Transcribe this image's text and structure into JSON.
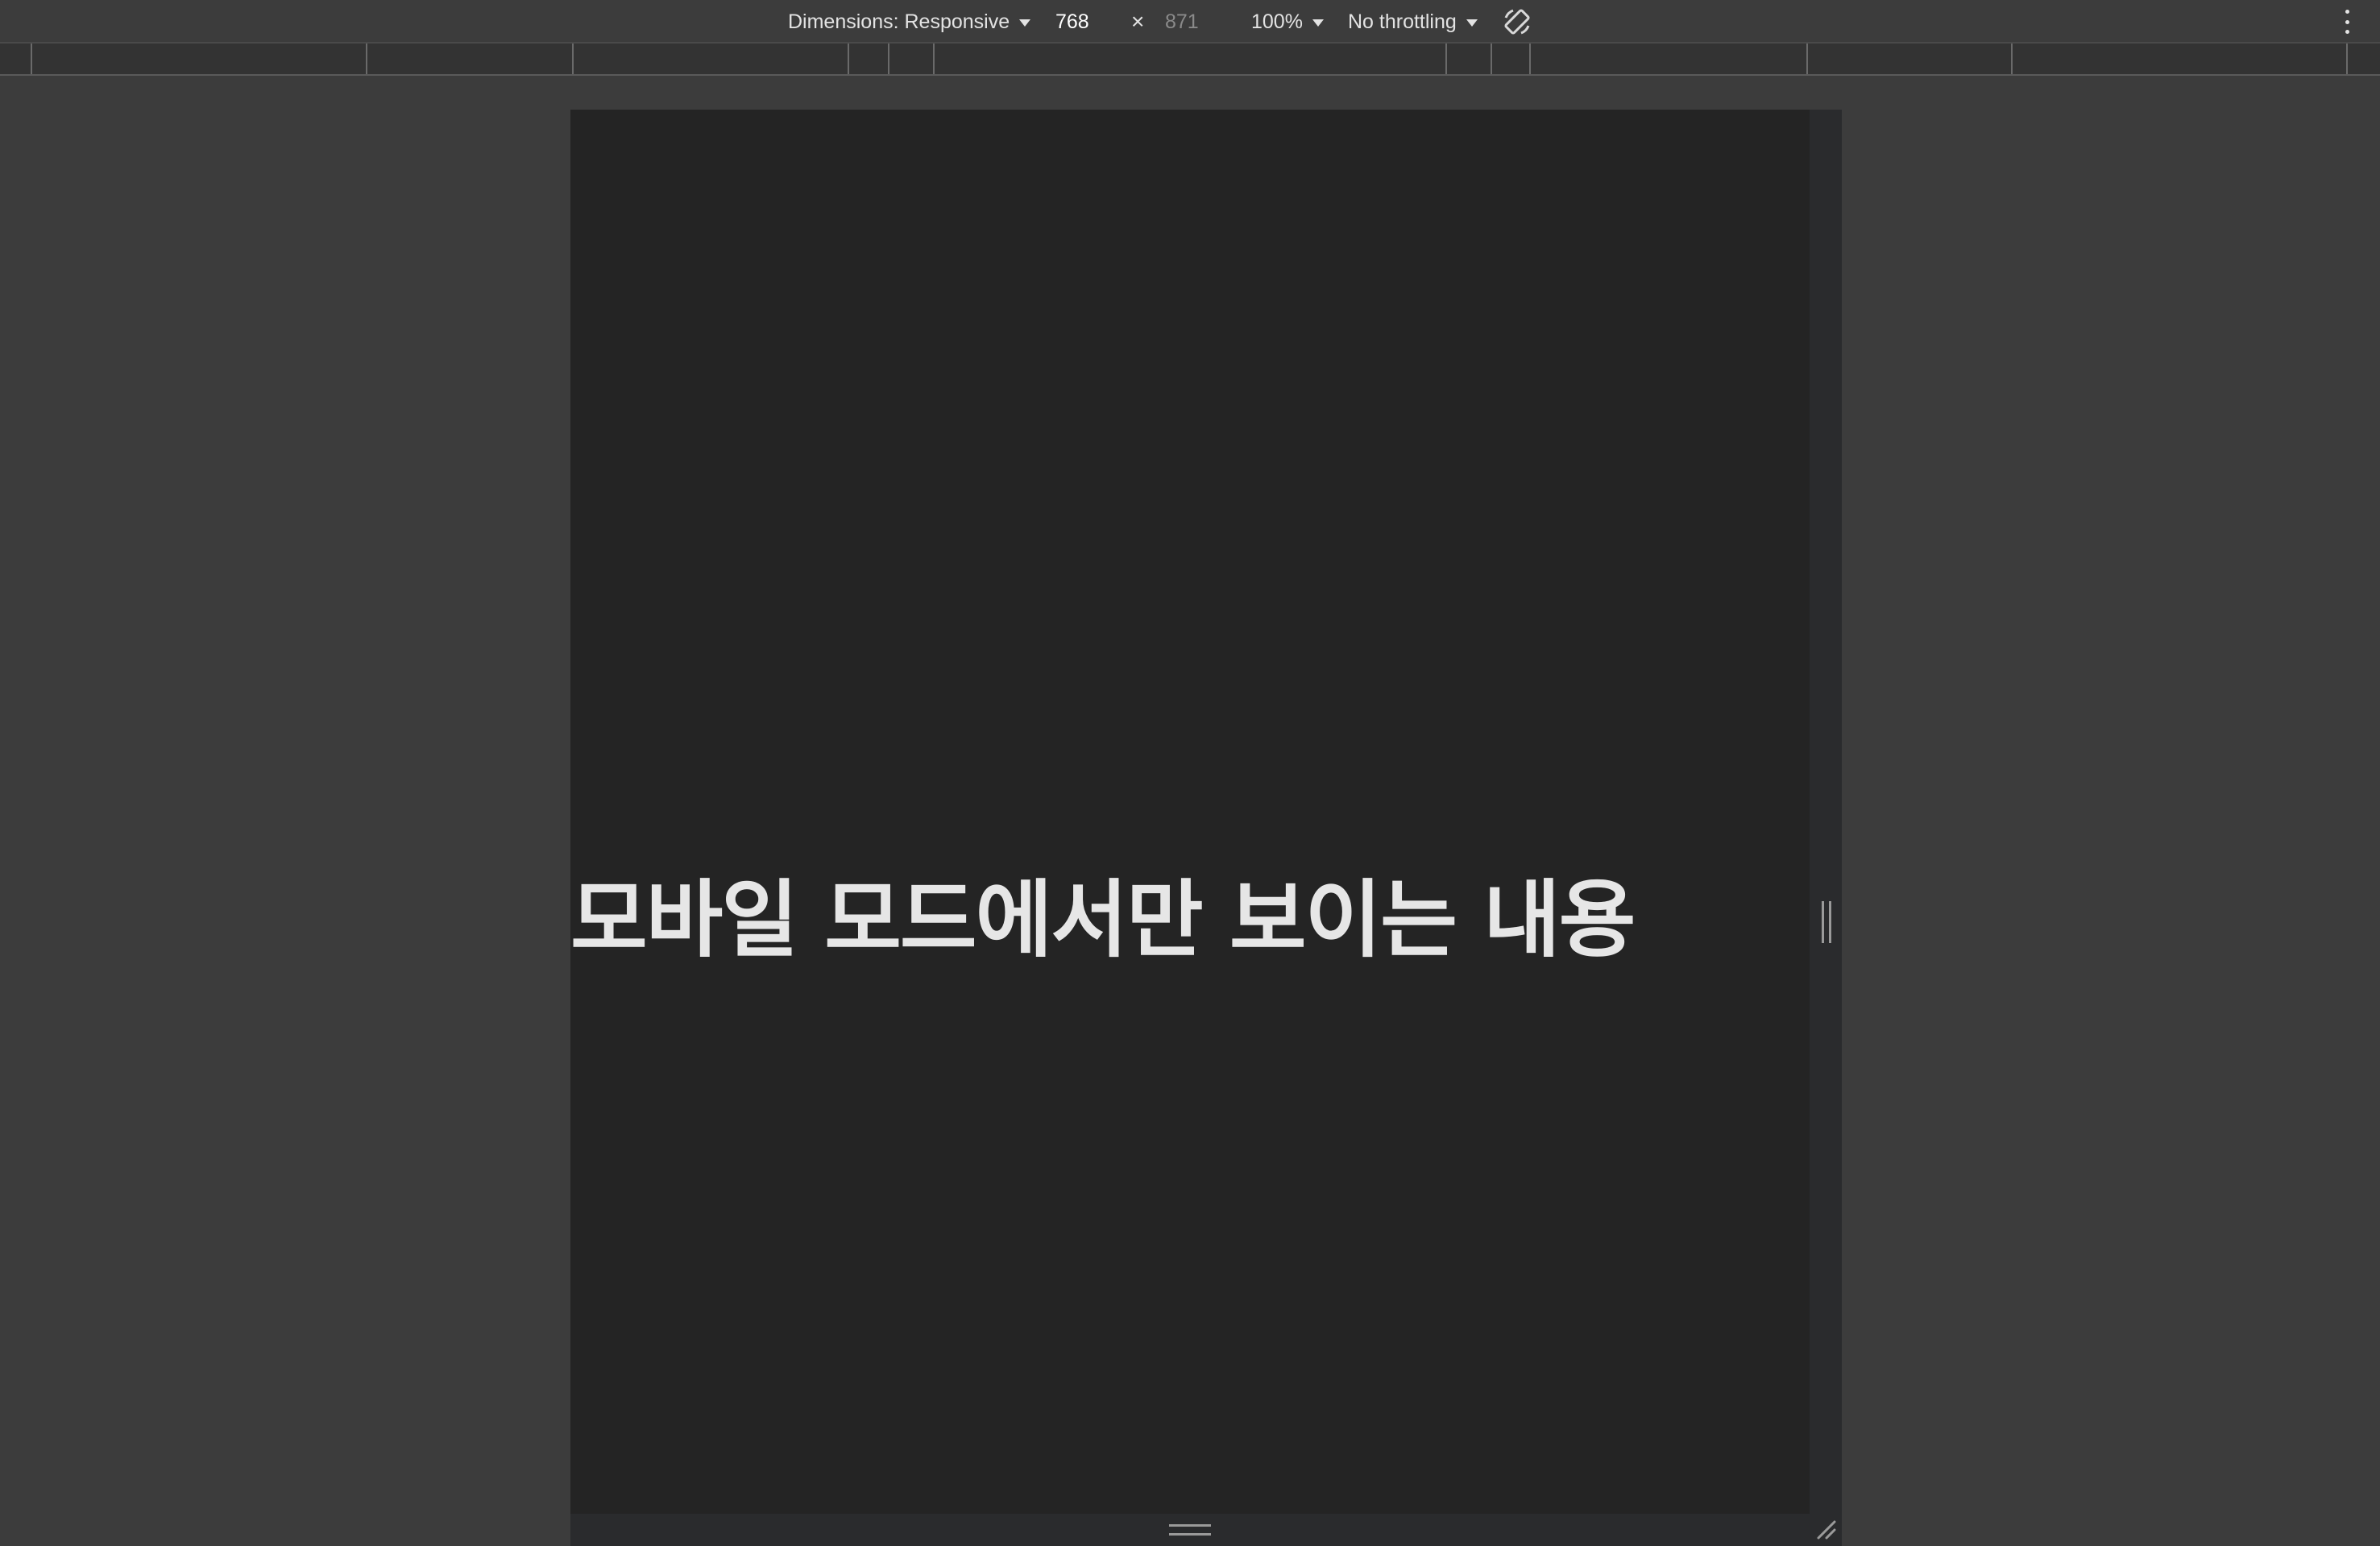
{
  "toolbar": {
    "dimensions_label": "Dimensions: Responsive",
    "width_value": "768",
    "times_symbol": "×",
    "height_value": "871",
    "zoom_label": "100%",
    "throttling_label": "No throttling",
    "rotate_icon": "rotate-icon",
    "more_icon": "more-vert-icon"
  },
  "page": {
    "content_text": "모바일 모드에서만 보이는 내용"
  },
  "colors": {
    "toolbar_bg": "#3c3c3c",
    "viewport_bg": "#242424",
    "text": "#e6e6e6"
  }
}
